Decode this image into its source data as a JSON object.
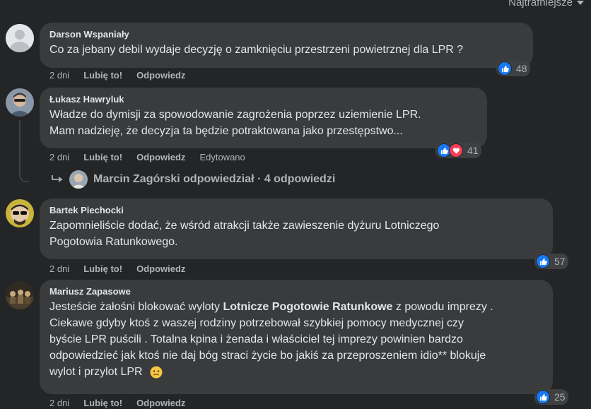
{
  "sort": {
    "label": "Najtrafniejsze"
  },
  "colors": {
    "like": "#1877f2",
    "love": "#f33e58",
    "bubble": "#3a3b3c",
    "background": "#242526"
  },
  "comments": [
    {
      "author": "Darson Wspaniały",
      "text": "Co za jebany debil wydaje decyzję o zamknięciu przestrzeni powietrznej dla LPR ?",
      "time": "2 dni",
      "like_label": "Lubię to!",
      "reply_label": "Odpowiedz",
      "reactions": {
        "icons": [
          "like-icon"
        ],
        "count": "48"
      },
      "avatar": "default-avatar-icon"
    },
    {
      "author": "Łukasz Hawryluk",
      "text_line1": "Władze do dymisji za spowodowanie zagrożenia poprzez uziemienie LPR.",
      "text_line2": "Mam nadzieję, że decyzja ta będzie potraktowana jako przestępstwo...",
      "time": "2 dni",
      "like_label": "Lubię to!",
      "reply_label": "Odpowiedz",
      "edited_label": "Edytowano",
      "reactions": {
        "icons": [
          "like-icon",
          "love-icon"
        ],
        "count": "41"
      },
      "replies_summary": "Marcin Zagórski odpowiedział · 4 odpowiedzi"
    },
    {
      "author": "Bartek Piechocki",
      "text_line1": "Zapomnieliście dodać, że wśród atrakcji także zawieszenie dyżuru Lotniczego",
      "text_line2": "Pogotowia Ratunkowego.",
      "time": "2 dni",
      "like_label": "Lubię to!",
      "reply_label": "Odpowiedz",
      "reactions": {
        "icons": [
          "like-icon"
        ],
        "count": "57"
      }
    },
    {
      "author": "Mariusz Zapasowe",
      "text_pre": "Jesteście żałośni blokować wyloty ",
      "text_bold": "Lotnicze Pogotowie Ratunkowe",
      "text_post1": " z powodu imprezy .",
      "text_line2": "Ciekawe gdyby ktoś z waszej rodziny potrzebował szybkiej pomocy medycznej czy",
      "text_line3": "byście LPR puścili . Totalna kpina i żenada i właściciel tej imprezy powinien bardzo",
      "text_line4": "odpowiedzieć jak ktoś nie daj bóg straci życie bo jakiś za przeproszeniem idio** blokuje",
      "text_line5": "wylot i przylot LPR",
      "emoji": "sad-face-emoji",
      "time": "2 dni",
      "like_label": "Lubię to!",
      "reply_label": "Odpowiedz",
      "reactions": {
        "icons": [
          "like-icon"
        ],
        "count": "25"
      }
    }
  ]
}
